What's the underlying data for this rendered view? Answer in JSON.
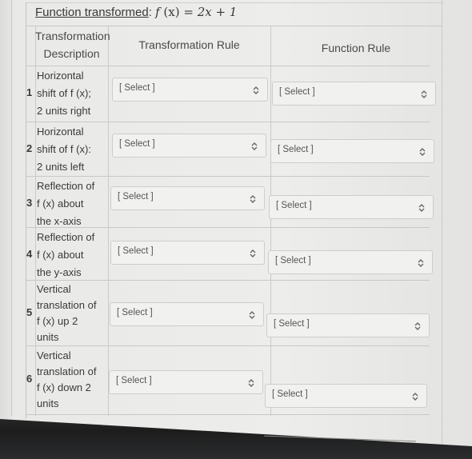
{
  "caption": {
    "label": "Function transformed",
    "separator": ": ",
    "function_name": "f",
    "function_arg": "(x)",
    "equals": " = ",
    "expression": "2x + 1"
  },
  "table": {
    "headers": {
      "description": "Transformation Description",
      "description_line1": "Transformation",
      "description_line2": "Description",
      "transformation_rule": "Transformation Rule",
      "function_rule": "Function Rule"
    },
    "rows": [
      {
        "number": "1",
        "lines": [
          "Horizontal",
          "shift of f (x);",
          "2 units right"
        ],
        "transformation_rule": "[ Select ]",
        "function_rule": "[ Select ]"
      },
      {
        "number": "2",
        "lines": [
          "Horizontal",
          "shift of f (x):",
          "2 units left"
        ],
        "transformation_rule": "[ Select ]",
        "function_rule": "[ Select ]"
      },
      {
        "number": "3",
        "lines": [
          "Reflection of",
          "f (x) about",
          "the x-axis"
        ],
        "transformation_rule": "[ Select ]",
        "function_rule": "[ Select ]"
      },
      {
        "number": "4",
        "lines": [
          "Reflection of",
          "f (x) about",
          "the y-axis"
        ],
        "transformation_rule": "[ Select ]",
        "function_rule": "[ Select ]"
      },
      {
        "number": "5",
        "lines": [
          "Vertical",
          "translation of",
          "f (x) up 2",
          "units"
        ],
        "transformation_rule": "[ Select ]",
        "function_rule": "[ Select ]"
      },
      {
        "number": "6",
        "lines": [
          "Vertical",
          "translation of",
          "f (x) down 2",
          "units"
        ],
        "transformation_rule": "[ Select ]",
        "function_rule": "[ Select ]"
      }
    ]
  },
  "icons": {
    "select_arrow": "up-down-chevron-icon"
  }
}
